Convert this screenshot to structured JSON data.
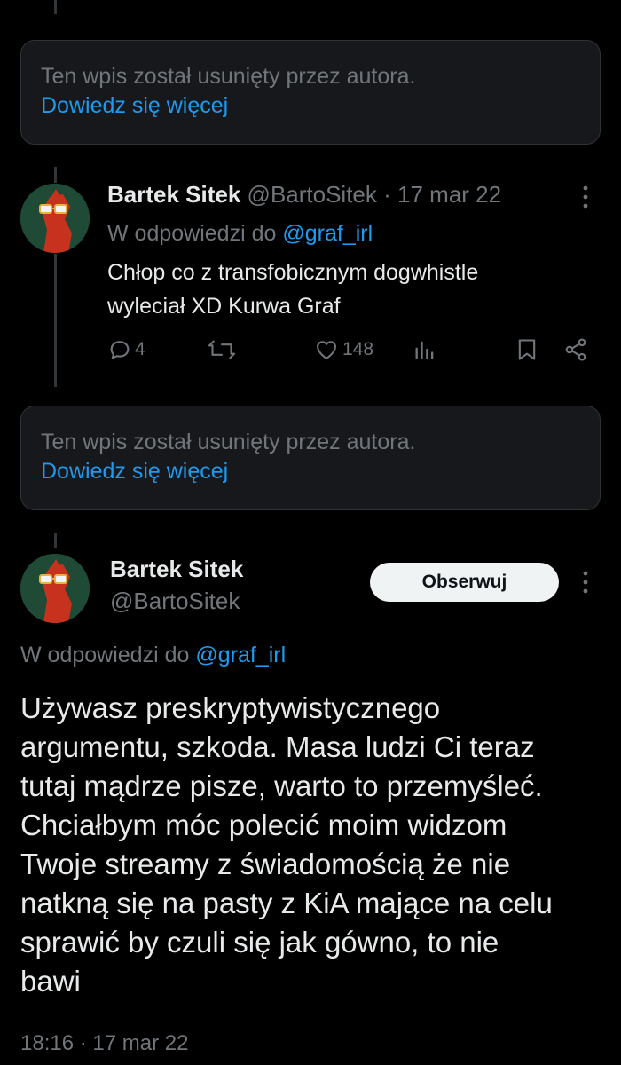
{
  "deleted_notice_1": {
    "text": "Ten wpis został usunięty przez autora.",
    "link": "Dowiedz się więcej"
  },
  "reply_tweet": {
    "name": "Bartek Sitek",
    "handle": "@BartoSitek",
    "separator": "·",
    "date": "17 mar 22",
    "reply_prefix": "W odpowiedzi do",
    "reply_mention": "@graf_irl",
    "text_line1": "Chłop co z transfobicznym dogwhistle",
    "text_line2": "wyleciał XD Kurwa Graf",
    "replies_count": "4",
    "likes_count": "148",
    "icons": [
      "reply-icon",
      "retweet-icon",
      "like-icon",
      "views-icon",
      "bookmark-icon",
      "share-icon",
      "more-icon"
    ]
  },
  "deleted_notice_2": {
    "text": "Ten wpis został usunięty przez autora.",
    "link": "Dowiedz się więcej"
  },
  "main_tweet": {
    "name": "Bartek Sitek",
    "handle": "@BartoSitek",
    "follow_label": "Obserwuj",
    "reply_prefix": "W odpowiedzi do",
    "reply_mention": "@graf_irl",
    "lines": [
      "Używasz preskryptywistycznego",
      "argumentu, szkoda. Masa ludzi Ci teraz",
      "tutaj mądrze pisze, warto to przemyśleć.",
      "Chciałbym móc polecić moim widzom",
      "Twoje streamy z świadomością że nie",
      "natkną się na pasty z KiA mające na celu",
      "sprawić by czuli się jak gówno, to nie",
      "bawi"
    ],
    "timestamp": "18:16 · 17 mar 22"
  },
  "colors": {
    "background": "#000000",
    "text": "#e7e9ea",
    "muted": "#71767b",
    "link": "#1d9bf0",
    "card": "#16181c"
  }
}
